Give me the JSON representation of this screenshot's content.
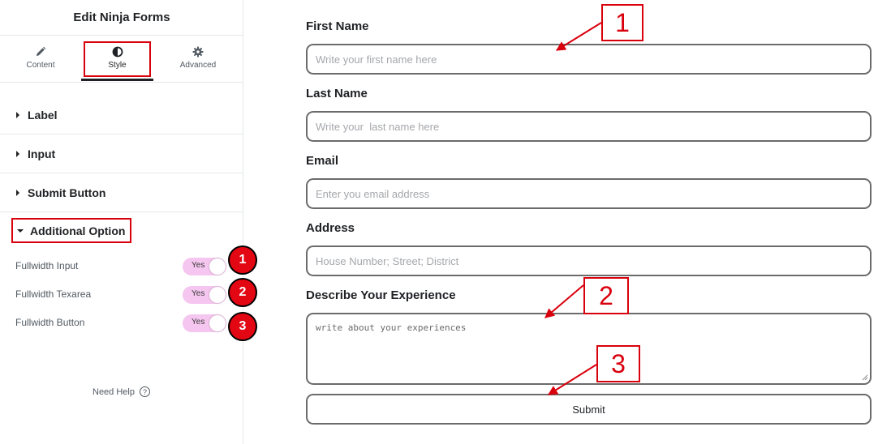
{
  "sidebar": {
    "title": "Edit Ninja Forms",
    "tabs": [
      {
        "label": "Content",
        "icon": "pencil-icon"
      },
      {
        "label": "Style",
        "icon": "contrast-icon",
        "active": true
      },
      {
        "label": "Advanced",
        "icon": "gear-icon"
      }
    ],
    "sections": [
      {
        "label": "Label",
        "expanded": false
      },
      {
        "label": "Input",
        "expanded": false
      },
      {
        "label": "Submit Button",
        "expanded": false
      },
      {
        "label": "Additional Option",
        "expanded": true
      }
    ],
    "options": [
      {
        "label": "Fullwidth Input",
        "toggle": "Yes"
      },
      {
        "label": "Fullwidth Texarea",
        "toggle": "Yes"
      },
      {
        "label": "Fullwidth Button",
        "toggle": "Yes"
      }
    ],
    "help": "Need Help"
  },
  "form": {
    "fields": [
      {
        "label": "First Name",
        "placeholder": "Write your first name here"
      },
      {
        "label": "Last Name",
        "placeholder": "Write your  last name here"
      },
      {
        "label": "Email",
        "placeholder": "Enter you email address"
      },
      {
        "label": "Address",
        "placeholder": "House Number; Street; District"
      }
    ],
    "textarea": {
      "label": "Describe Your Experience",
      "placeholder": "write about your experiences"
    },
    "submit_label": "Submit"
  },
  "annotations": {
    "badges": [
      "1",
      "2",
      "3"
    ],
    "callouts": [
      "1",
      "2",
      "3"
    ]
  },
  "colors": {
    "annotation_red": "#d9000d",
    "toggle_pink": "#f5c6ef",
    "badge_red": "#e30613"
  }
}
